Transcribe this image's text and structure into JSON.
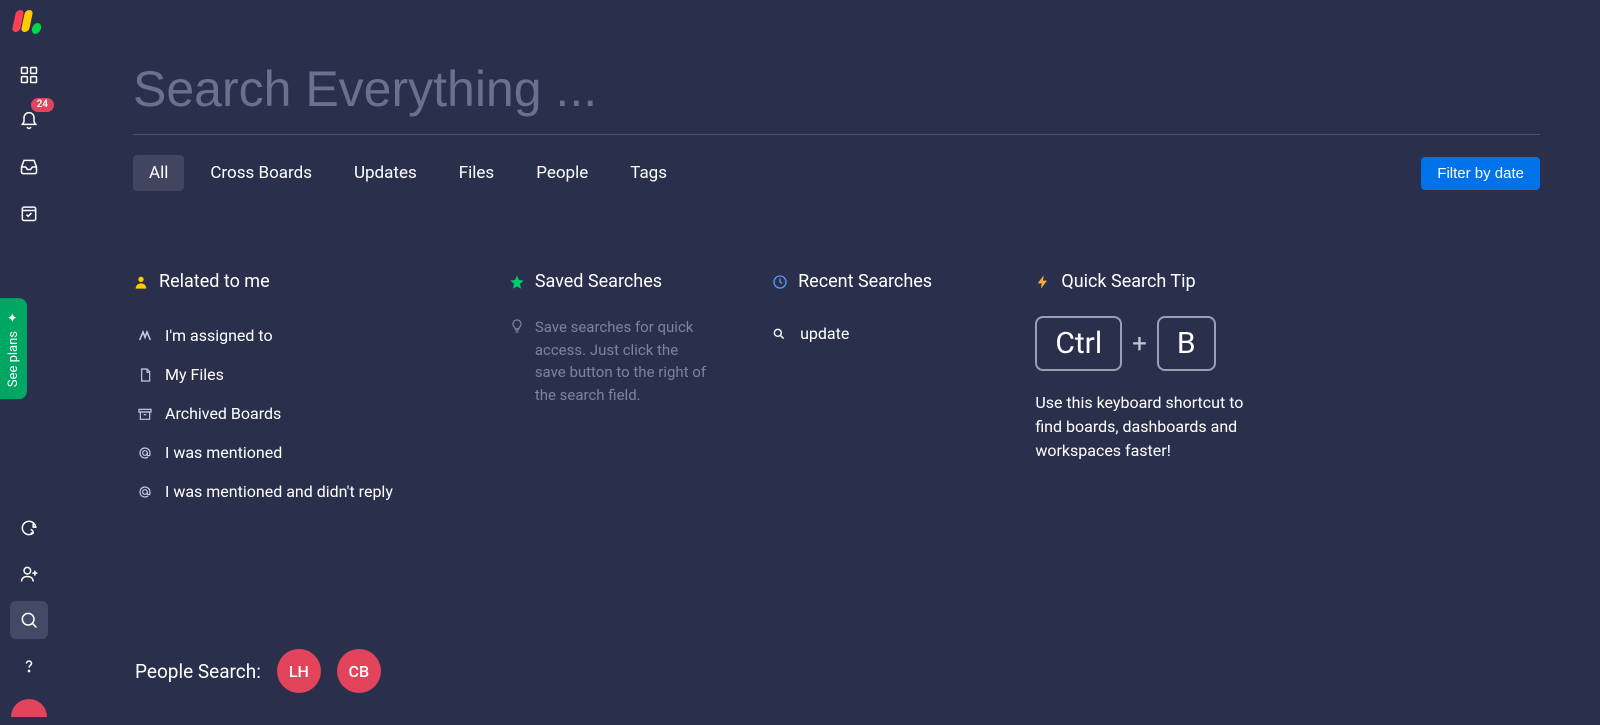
{
  "sidebar": {
    "notification_count": "24",
    "see_plans": "See plans"
  },
  "search": {
    "placeholder": "Search Everything ..."
  },
  "tabs": [
    "All",
    "Cross Boards",
    "Updates",
    "Files",
    "People",
    "Tags"
  ],
  "filter_button": "Filter by date",
  "columns": {
    "related": {
      "title": "Related to me",
      "items": [
        "I'm assigned to",
        "My Files",
        "Archived Boards",
        "I was mentioned",
        "I was mentioned and didn't reply"
      ]
    },
    "saved": {
      "title": "Saved Searches",
      "hint": "Save searches for quick access. Just click the save button to the right of the search field."
    },
    "recent": {
      "title": "Recent Searches",
      "items": [
        "update"
      ]
    },
    "tip": {
      "title": "Quick Search Tip",
      "key1": "Ctrl",
      "plus": "+",
      "key2": "B",
      "text": "Use this keyboard shortcut to find boards, dashboards and workspaces faster!"
    }
  },
  "people_search": {
    "label": "People Search:",
    "chips": [
      "LH",
      "CB"
    ]
  }
}
